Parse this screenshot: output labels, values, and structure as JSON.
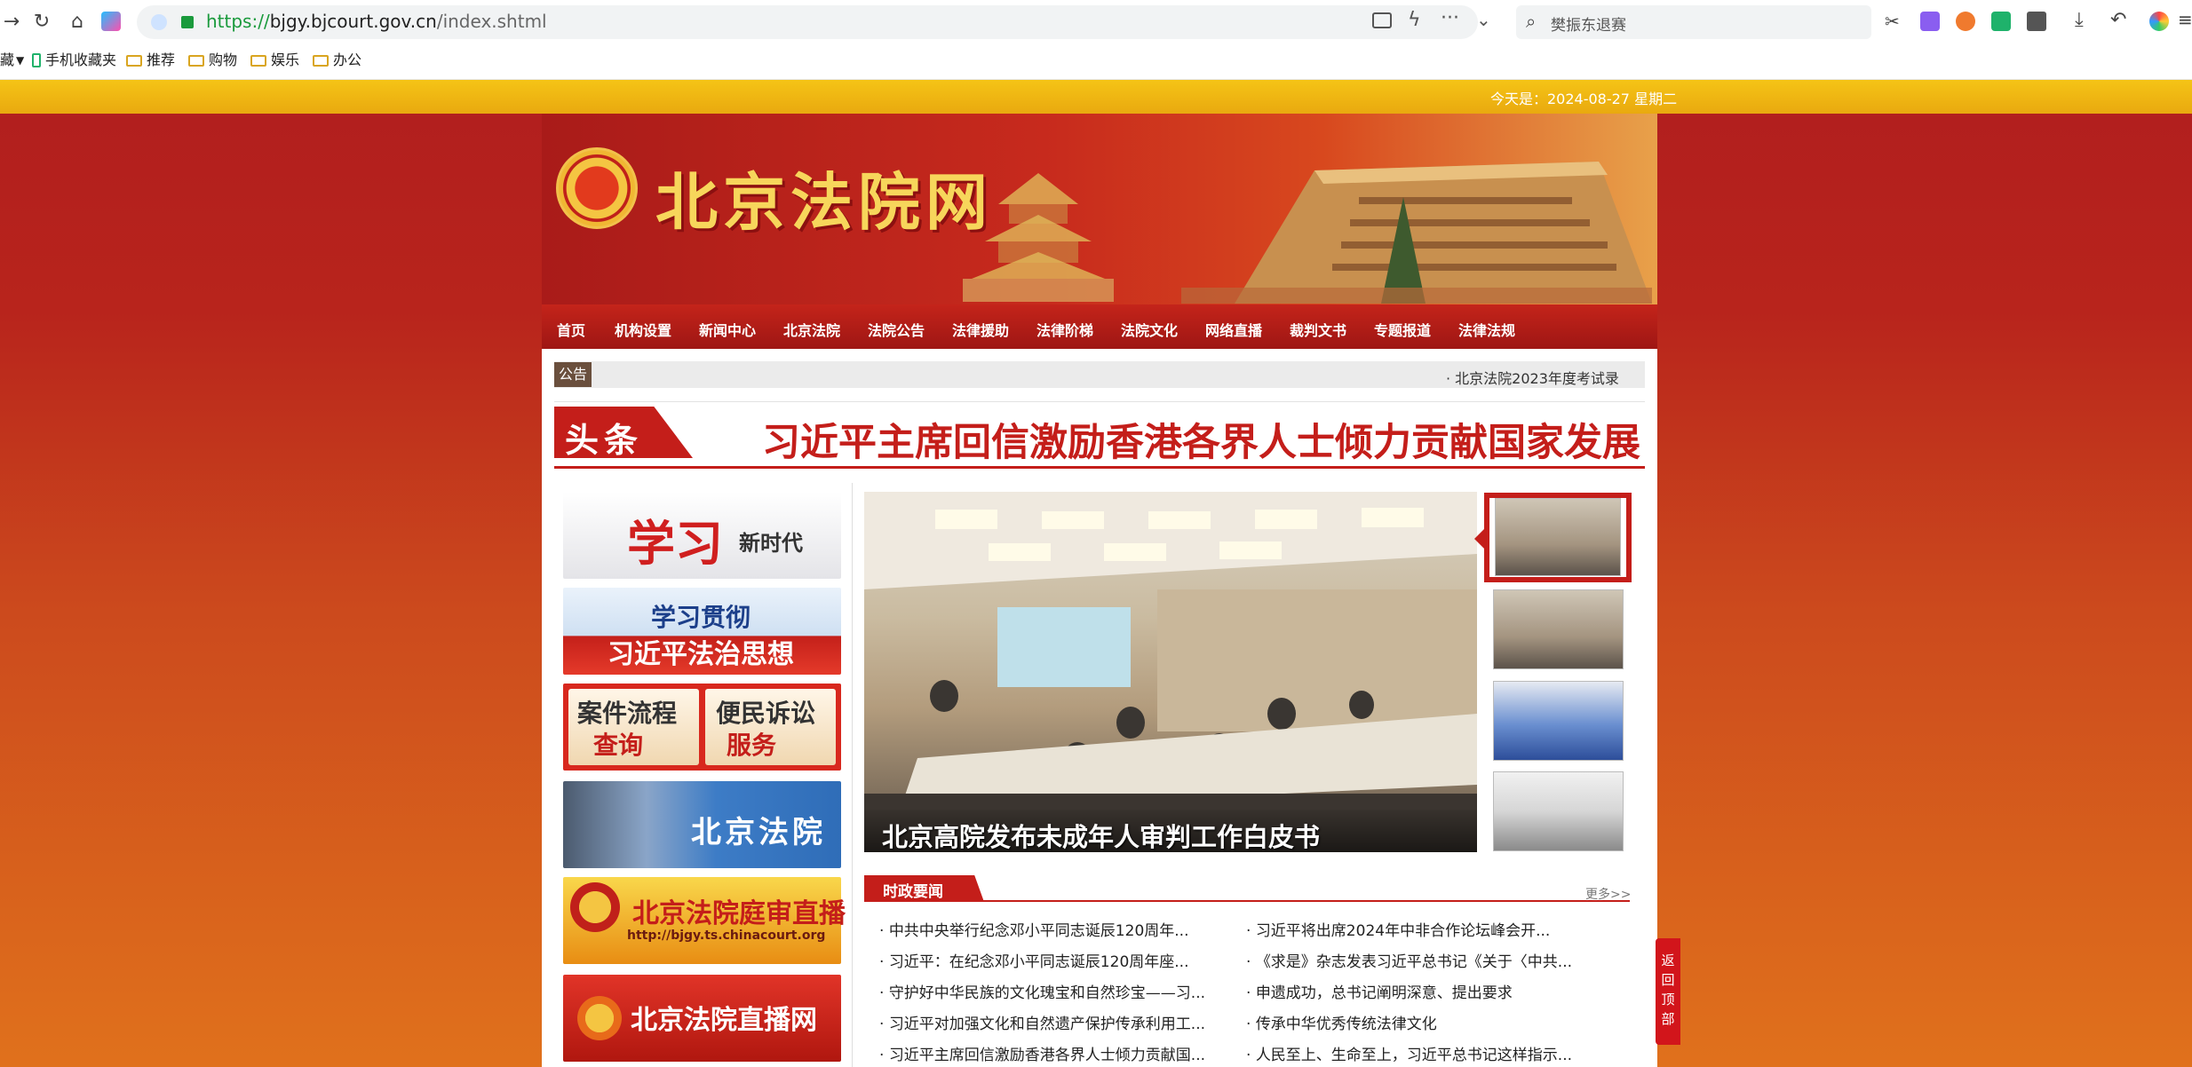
{
  "browser": {
    "url_scheme": "https://",
    "url_host": "bjgy.bjcourt.gov.cn",
    "url_path": "/index.shtml",
    "search_placeholder": "樊振东退赛",
    "bookmarks": [
      "手机收藏夹",
      "推荐",
      "购物",
      "娱乐",
      "办公"
    ],
    "bookmarks_lead": "藏"
  },
  "topbar": {
    "date_text": "今天是：2024-08-27 星期二"
  },
  "header": {
    "site_name": "北京法院网"
  },
  "nav": {
    "items": [
      "首页",
      "机构设置",
      "新闻中心",
      "北京法院",
      "法院公告",
      "法律援助",
      "法律阶梯",
      "法院文化",
      "网络直播",
      "裁判文书",
      "专题报道",
      "法律法规"
    ]
  },
  "notice": {
    "label": "公告",
    "text": "· 北京法院2023年度考试录"
  },
  "headline": {
    "tag": "头条",
    "title": "习近平主席回信激励香港各界人士倾力贡献国家发展"
  },
  "sidebar": {
    "banners": [
      {
        "t1": "学习",
        "t2": "新时代"
      },
      {
        "t1": "学习贯彻",
        "t2": "习近平法治思想"
      },
      {
        "t1": "案件流程",
        "t2": "查询",
        "t3": "便民诉讼",
        "t4": "服务"
      },
      {
        "t1": "北京法院"
      },
      {
        "t1": "北京法院庭审直播",
        "t2": "http://bjgy.ts.chinacourt.org"
      },
      {
        "t1": "北京法院直播网"
      }
    ]
  },
  "slideshow": {
    "caption": "北京高院发布未成年人审判工作白皮书"
  },
  "news": {
    "title": "时政要闻",
    "more": "更多>>",
    "left": [
      "中共中央举行纪念邓小平同志诞辰120周年...",
      "习近平：在纪念邓小平同志诞辰120周年座...",
      "守护好中华民族的文化瑰宝和自然珍宝——习...",
      "习近平对加强文化和自然遗产保护传承利用工...",
      "习近平主席回信激励香港各界人士倾力贡献国..."
    ],
    "right": [
      "习近平将出席2024年中非合作论坛峰会开...",
      "《求是》杂志发表习近平总书记《关于〈中共...",
      "申遗成功，总书记阐明深意、提出要求",
      "传承中华优秀传统法律文化",
      "人民至上、生命至上，习近平总书记这样指示..."
    ]
  },
  "backtop": {
    "label": "返回顶部"
  }
}
